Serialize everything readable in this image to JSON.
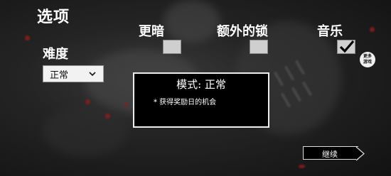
{
  "header": {
    "title": "选项"
  },
  "difficulty": {
    "label": "难度",
    "selected": "正常"
  },
  "options": {
    "darker": {
      "label": "更暗",
      "checked": false
    },
    "extra_locks": {
      "label": "额外的锁",
      "checked": false
    },
    "music": {
      "label": "音乐",
      "checked": true
    }
  },
  "more_games": {
    "line1": "更多",
    "line2": "游戏"
  },
  "mode_panel": {
    "title": "模式: 正常",
    "description": "* 获得奖励日的机会"
  },
  "continue_button": {
    "label": "继续"
  },
  "colors": {
    "panel_bg": "#000000",
    "text": "#ffffff",
    "checkbox": "#cfcfcf"
  }
}
